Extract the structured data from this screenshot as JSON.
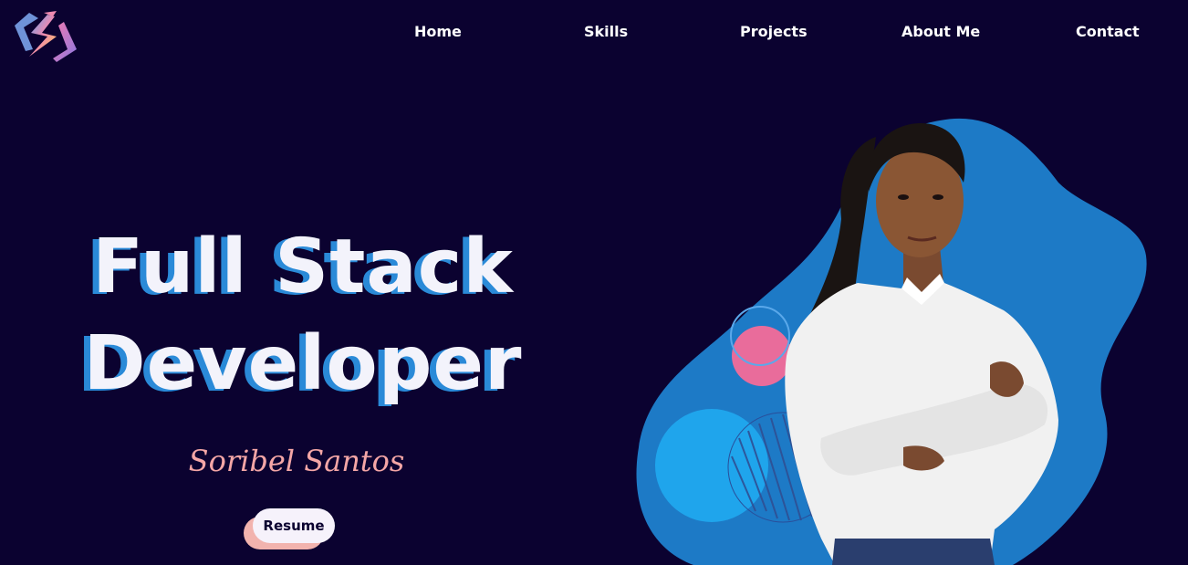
{
  "logo": {
    "icon": "s-lightning-logo-icon"
  },
  "nav": {
    "items": [
      {
        "label": "Home"
      },
      {
        "label": "Skills"
      },
      {
        "label": "Projects"
      },
      {
        "label": "About Me"
      },
      {
        "label": "Contact"
      }
    ]
  },
  "hero": {
    "headline_line1": "Full Stack",
    "headline_line2": "Developer",
    "name": "Soribel Santos",
    "resume_label": "Resume"
  },
  "colors": {
    "background": "#0b0230",
    "accent_blue": "#2a8ad8",
    "blob_blue": "#1d7ac6",
    "pink": "#f4a6a6",
    "text": "#f3f3fb"
  }
}
